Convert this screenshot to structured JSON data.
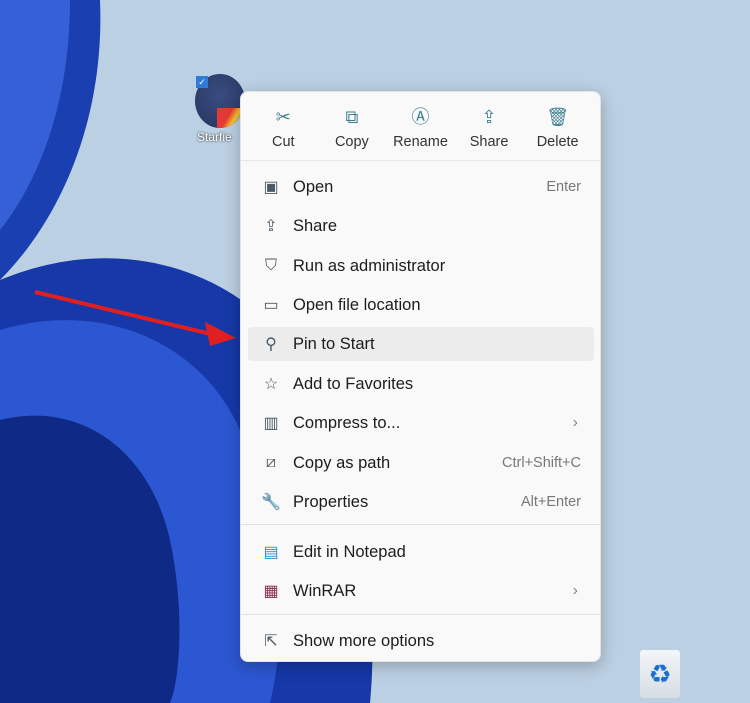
{
  "desktop": {
    "icon_label": "Starfie",
    "colors": {
      "swirl": "#1a3fb0",
      "background": "#bcd0e3",
      "arrow": "#e02020"
    }
  },
  "menu": {
    "toolbar": [
      {
        "label": "Cut",
        "icon": "scissors-icon",
        "glyph": "✂"
      },
      {
        "label": "Copy",
        "icon": "copy-icon",
        "glyph": "⧉"
      },
      {
        "label": "Rename",
        "icon": "rename-icon",
        "glyph": "Ⓐ"
      },
      {
        "label": "Share",
        "icon": "share-icon",
        "glyph": "⇪"
      },
      {
        "label": "Delete",
        "icon": "trash-icon",
        "glyph": "🗑"
      }
    ],
    "items": [
      {
        "label": "Open",
        "shortcut": "Enter",
        "glyph": "▣"
      },
      {
        "label": "Share",
        "glyph": "⇪"
      },
      {
        "label": "Run as administrator",
        "glyph": "⛉"
      },
      {
        "label": "Open file location",
        "glyph": "▭"
      },
      {
        "label": "Pin to Start",
        "glyph": "⚲"
      },
      {
        "label": "Add to Favorites",
        "glyph": "☆"
      },
      {
        "label": "Compress to...",
        "glyph": "▥",
        "submenu": "›"
      },
      {
        "label": "Copy as path",
        "shortcut": "Ctrl+Shift+C",
        "glyph": "⧄"
      },
      {
        "label": "Properties",
        "shortcut": "Alt+Enter",
        "glyph": "🔧"
      },
      {
        "label": "Edit in Notepad",
        "glyph": "▤"
      },
      {
        "label": "WinRAR",
        "glyph": "▦",
        "submenu": "›"
      },
      {
        "label": "Show more options",
        "glyph": "⇱"
      }
    ]
  }
}
